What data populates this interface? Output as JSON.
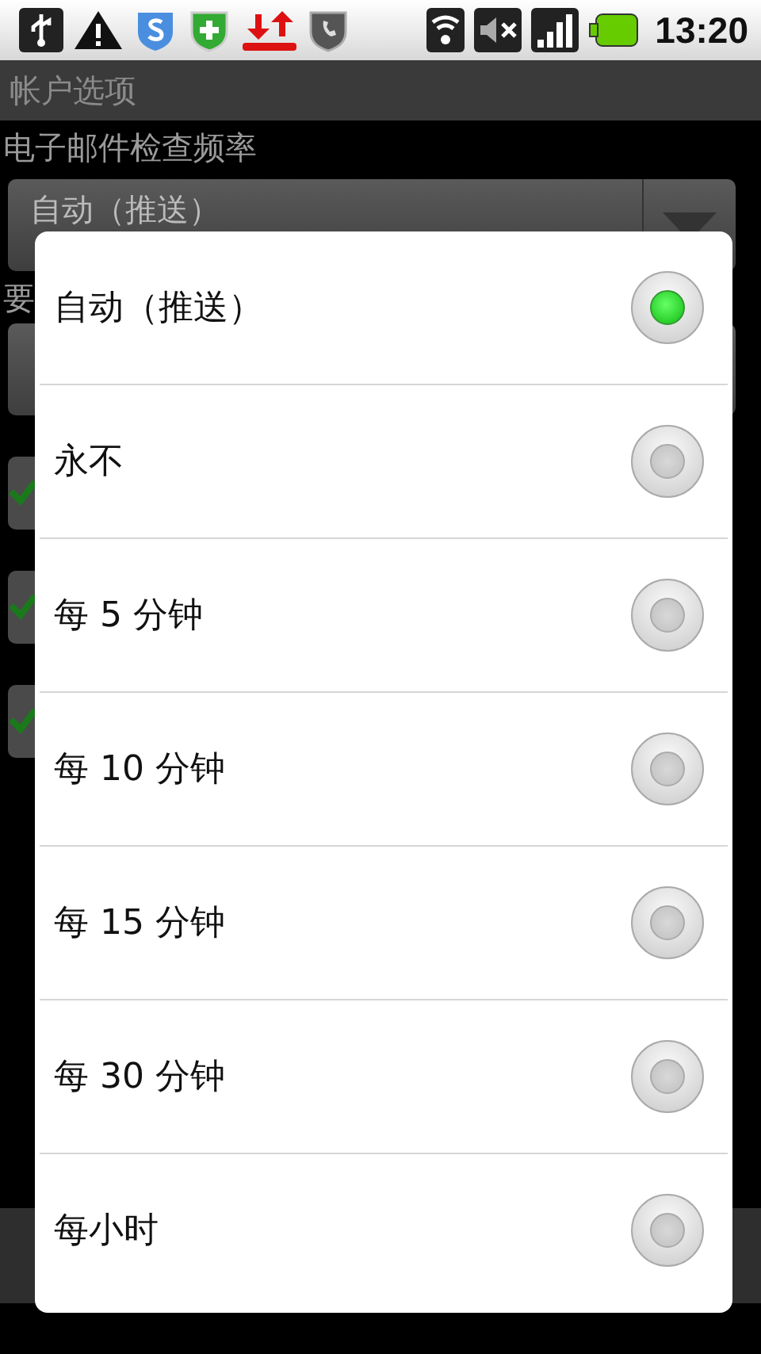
{
  "status_bar": {
    "time": "13:20"
  },
  "title_bar": {
    "title": "帐户选项"
  },
  "settings": {
    "check_frequency_label": "电子邮件检查频率",
    "check_frequency_value": "自动（推送）",
    "next_label": "要",
    "checkboxes": [
      {
        "checked": true
      },
      {
        "checked": true
      },
      {
        "checked": true
      }
    ]
  },
  "dialog": {
    "options": [
      {
        "label": "自动（推送）",
        "selected": true
      },
      {
        "label": "永不",
        "selected": false
      },
      {
        "label": "每 5 分钟",
        "selected": false
      },
      {
        "label": "每 10 分钟",
        "selected": false
      },
      {
        "label": "每 15 分钟",
        "selected": false
      },
      {
        "label": "每 30 分钟",
        "selected": false
      },
      {
        "label": "每小时",
        "selected": false
      }
    ]
  }
}
